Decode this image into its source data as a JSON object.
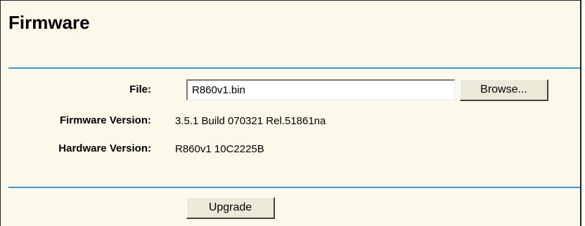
{
  "page": {
    "title": "Firmware"
  },
  "form": {
    "file": {
      "label": "File:",
      "value": "R860v1.bin",
      "browse_label": "Browse..."
    },
    "firmware_version": {
      "label": "Firmware Version:",
      "value": "3.5.1 Build 070321 Rel.51861na"
    },
    "hardware_version": {
      "label": "Hardware Version:",
      "value": "R860v1 10C2225B"
    },
    "upgrade_label": "Upgrade"
  },
  "colors": {
    "panel_background": "#fcf8ea",
    "rule": "#3b9ad6",
    "button_face": "#ece9d8"
  }
}
